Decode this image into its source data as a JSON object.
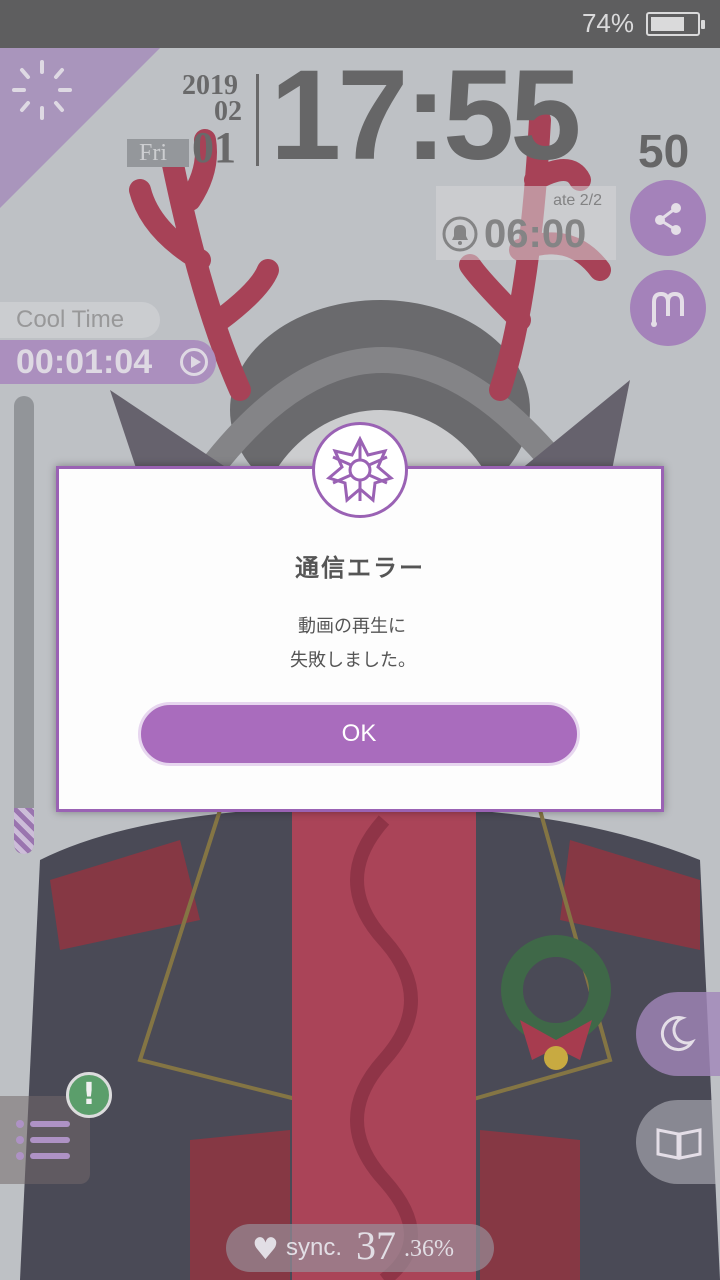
{
  "status_bar": {
    "battery_percent": "74%",
    "battery_level": 0.74
  },
  "clock": {
    "year": "2019",
    "month": "02",
    "weekday": "Fri",
    "day": "01",
    "time": "17:55",
    "seconds": "50"
  },
  "alarm": {
    "label": "ate 2/2",
    "time": "06:00"
  },
  "cool_time": {
    "label": "Cool Time",
    "timer": "00:01:04",
    "gauge_level": 0.1
  },
  "sync": {
    "label": "sync.",
    "integer": "37",
    "decimal": ".36%"
  },
  "dialog": {
    "title": "通信エラー",
    "message_line1": "動画の再生に",
    "message_line2": "失敗しました。",
    "ok_label": "OK"
  },
  "colors": {
    "accent": "#a96cbd",
    "status_bar": "#616161"
  },
  "icons": [
    "loading-spinner-icon",
    "bell-icon",
    "share-icon",
    "m-logo-icon",
    "moon-icon",
    "book-icon",
    "menu-icon",
    "exclamation-icon",
    "heart-icon",
    "snowflake-emblem-icon"
  ]
}
